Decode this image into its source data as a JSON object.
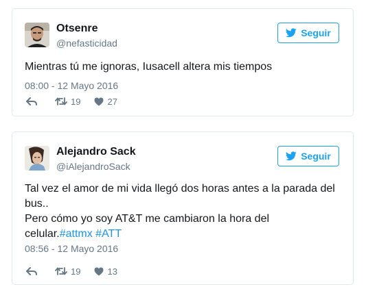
{
  "tweets": [
    {
      "name": "Otsenre",
      "handle": "@nefasticidad",
      "follow_label": "Seguir",
      "text_lines": [
        "Mientras tú me ignoras, Iusacell altera mis tiempos"
      ],
      "timestamp": "08:00 - 12 Mayo 2016",
      "retweets": "19",
      "likes": "27"
    },
    {
      "name": "Alejandro Sack",
      "handle": "@iAlejandroSack",
      "follow_label": "Seguir",
      "text_lines": [
        "Tal vez el amor de mi vida llegó dos horas antes a la parada del",
        "bus..",
        "Pero cómo yo soy AT&T me cambiaron la hora del"
      ],
      "text_last_prefix": "celular.",
      "hashtags": [
        "#attmx",
        "#ATT"
      ],
      "timestamp": "08:56 - 12 Mayo 2016",
      "retweets": "19",
      "likes": "13"
    }
  ],
  "icons": {
    "follow": "twitter-bird-icon",
    "reply": "reply-icon",
    "retweet": "retweet-icon",
    "like": "heart-icon"
  },
  "colors": {
    "accent": "#1da1f2",
    "hashtag": "#1b95e0",
    "muted": "#657786",
    "border": "#e1e8ed"
  }
}
